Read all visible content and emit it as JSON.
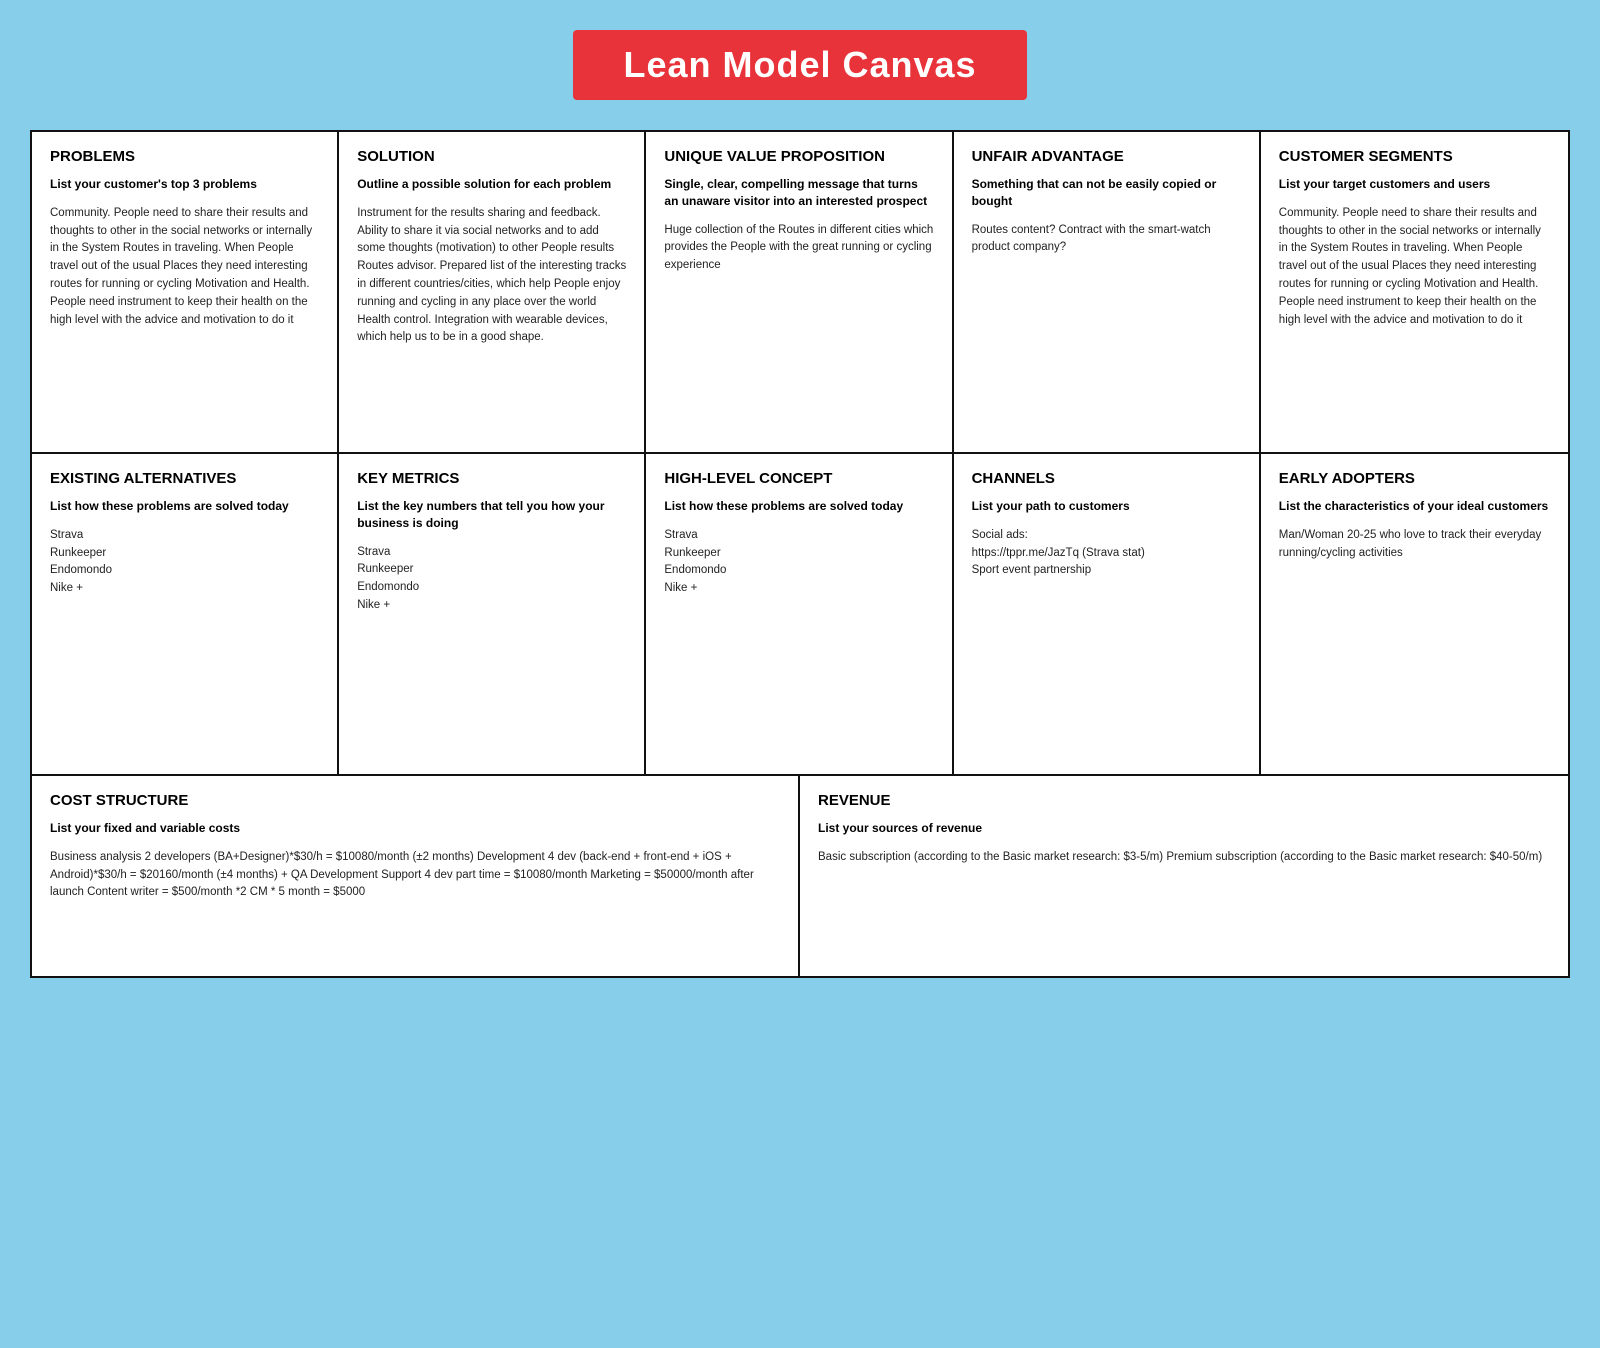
{
  "title": "Lean Model Canvas",
  "sections": {
    "top": [
      {
        "id": "problems",
        "title": "PROBLEMS",
        "subtitle": "List your customer's top 3 problems",
        "body": "Community. People need to share their results and thoughts to other in the social networks or internally in the System Routes in traveling. When People travel out of the usual Places they need interesting routes for running or cycling Motivation and Health. People need instrument to keep their health on the high level with the advice and motivation to do it"
      },
      {
        "id": "solution",
        "title": "SOLUTION",
        "subtitle": "Outline a possible solution  for each problem",
        "body": "Instrument for the results sharing and feedback. Ability to share it via social networks and to add some thoughts (motivation) to other People results Routes advisor. Prepared list of the interesting tracks in different countries/cities, which help People enjoy running and cycling in any place over the world Health control. Integration with wearable devices, which help us to be in a good shape."
      },
      {
        "id": "unique-value",
        "title": "UNIQUE VALUE PROPOSITION",
        "subtitle": "Single, clear, compelling message that turns an unaware visitor into an interested prospect",
        "body": "Huge collection of the Routes in different cities which provides the People with the great running or cycling experience"
      },
      {
        "id": "unfair-advantage",
        "title": "UNFAIR ADVANTAGE",
        "subtitle": "Something that can not be easily copied or bought",
        "body": "Routes content?  Contract with the smart-watch product company?"
      },
      {
        "id": "customer-segments",
        "title": "CUSTOMER SEGMENTS",
        "subtitle": "List your target customers and users",
        "body": "Community. People need to share their results and thoughts to other in the social networks or internally in the System Routes in traveling. When People travel out of the usual Places they need interesting routes for running or cycling Motivation and Health. People need instrument to keep their health on the high level with the advice and motivation to do it"
      }
    ],
    "middle": [
      {
        "id": "existing-alternatives",
        "title": "EXISTING ALTERNATIVES",
        "subtitle": "List how these problems are solved today",
        "body": "Strava\nRunkeeper\nEndomondo\nNike +"
      },
      {
        "id": "key-metrics",
        "title": "KEY METRICS",
        "subtitle": "List the key numbers that tell you how your business is doing",
        "body": "Strava\nRunkeeper\nEndomondo\nNike +"
      },
      {
        "id": "high-level-concept",
        "title": "HIGH-LEVEL CONCEPT",
        "subtitle": "List how these problems are solved today",
        "body": "Strava\nRunkeeper\nEndomondo\nNike +"
      },
      {
        "id": "channels",
        "title": "CHANNELS",
        "subtitle": "List your path to customers",
        "body": "Social ads:\nhttps://tppr.me/JazTq (Strava stat)\nSport event partnership"
      },
      {
        "id": "early-adopters",
        "title": "EARLY ADOPTERS",
        "subtitle": "List the characteristics of your ideal customers",
        "body": "Man/Woman 20-25 who love to track their everyday running/cycling activities"
      }
    ],
    "bottom": [
      {
        "id": "cost-structure",
        "title": "COST STRUCTURE",
        "subtitle": "List your fixed and variable costs",
        "body": "Business analysis 2 developers (BA+Designer)*$30/h = $10080/month (±2 months) Development 4 dev (back-end + front-end + iOS + Android)*$30/h = $20160/month (±4 months) + QA Development Support 4 dev part time = $10080/month Marketing = $50000/month after launch  Content writer = $500/month *2 CM * 5 month = $5000"
      },
      {
        "id": "revenue",
        "title": "REVENUE",
        "subtitle": "List your sources of revenue",
        "body": "Basic subscription (according to the Basic market research: $3-5/m) Premium subscription (according to the Basic market research: $40-50/m)"
      }
    ]
  }
}
